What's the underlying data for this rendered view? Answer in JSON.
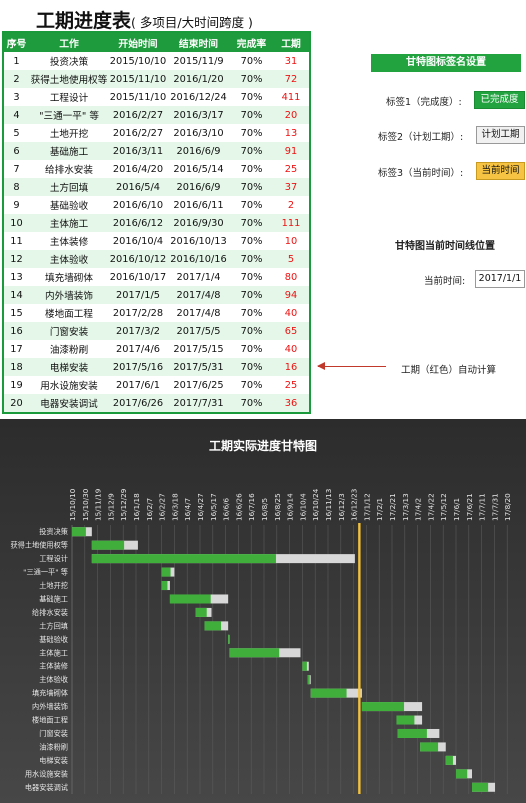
{
  "title": {
    "main": "工期进度表",
    "sub": "( 多项目/大时间跨度 )"
  },
  "table": {
    "headers": [
      "序号",
      "工作",
      "开始时间",
      "结束时间",
      "完成率",
      "工期"
    ],
    "rows": [
      [
        "1",
        "投资决策",
        "2015/10/10",
        "2015/11/9",
        "70%",
        "31"
      ],
      [
        "2",
        "获得土地使用权等",
        "2015/11/10",
        "2016/1/20",
        "70%",
        "72"
      ],
      [
        "3",
        "工程设计",
        "2015/11/10",
        "2016/12/24",
        "70%",
        "411"
      ],
      [
        "4",
        "\"三通一平\" 等",
        "2016/2/27",
        "2016/3/17",
        "70%",
        "20"
      ],
      [
        "5",
        "土地开挖",
        "2016/2/27",
        "2016/3/10",
        "70%",
        "13"
      ],
      [
        "6",
        "基础施工",
        "2016/3/11",
        "2016/6/9",
        "70%",
        "91"
      ],
      [
        "7",
        "给排水安装",
        "2016/4/20",
        "2016/5/14",
        "70%",
        "25"
      ],
      [
        "8",
        "土方回填",
        "2016/5/4",
        "2016/6/9",
        "70%",
        "37"
      ],
      [
        "9",
        "基础验收",
        "2016/6/10",
        "2016/6/11",
        "70%",
        "2"
      ],
      [
        "10",
        "主体施工",
        "2016/6/12",
        "2016/9/30",
        "70%",
        "111"
      ],
      [
        "11",
        "主体装修",
        "2016/10/4",
        "2016/10/13",
        "70%",
        "10"
      ],
      [
        "12",
        "主体验收",
        "2016/10/12",
        "2016/10/16",
        "70%",
        "5"
      ],
      [
        "13",
        "填充墙砌体",
        "2016/10/17",
        "2017/1/4",
        "70%",
        "80"
      ],
      [
        "14",
        "内外墙装饰",
        "2017/1/5",
        "2017/4/8",
        "70%",
        "94"
      ],
      [
        "15",
        "楼地面工程",
        "2017/2/28",
        "2017/4/8",
        "70%",
        "40"
      ],
      [
        "16",
        "门窗安装",
        "2017/3/2",
        "2017/5/5",
        "70%",
        "65"
      ],
      [
        "17",
        "油漆粉刷",
        "2017/4/6",
        "2017/5/15",
        "70%",
        "40"
      ],
      [
        "18",
        "电梯安装",
        "2017/5/16",
        "2017/5/31",
        "70%",
        "16"
      ],
      [
        "19",
        "用水设施安装",
        "2017/6/1",
        "2017/6/25",
        "70%",
        "25"
      ],
      [
        "20",
        "电器安装调试",
        "2017/6/26",
        "2017/7/31",
        "70%",
        "36"
      ]
    ]
  },
  "settings": {
    "title": "甘特图标签名设置",
    "label1": "标签1（完成度）:",
    "value1": "已完成度",
    "label2": "标签2（计划工期）:",
    "value2": "计划工期",
    "label3": "标签3（当前时间）:",
    "value3": "当前时间",
    "section_title": "甘特图当前时间线位置",
    "current_label": "当前时间:",
    "current_value": "2017/1/1",
    "note": "工期（红色）自动计算"
  },
  "colors": {
    "header_green": "#1e9b3c",
    "row_alt": "#e4f7e8",
    "duration_red": "#e11111",
    "btn_green": "#22a340",
    "btn_yellow": "#f6c342",
    "chart_bg": "#3b3b3b",
    "bar_done": "#3fae3a",
    "bar_plan": "#d8d8d8",
    "today_line": "#f3c13a"
  },
  "chart_data": {
    "type": "bar",
    "subtype": "gantt",
    "title": "工期实际进度甘特图",
    "tick_labels": [
      "15/10/10",
      "15/10/30",
      "15/11/19",
      "15/12/9",
      "15/12/29",
      "16/1/18",
      "16/2/7",
      "16/2/27",
      "16/3/18",
      "16/4/7",
      "16/4/27",
      "16/5/17",
      "16/6/6",
      "16/6/26",
      "16/7/16",
      "16/8/5",
      "16/8/25",
      "16/9/14",
      "16/10/4",
      "16/10/24",
      "16/11/13",
      "16/12/3",
      "16/12/23",
      "17/1/12",
      "17/2/1",
      "17/2/21",
      "17/3/13",
      "17/4/2",
      "17/4/22",
      "17/5/12",
      "17/6/1",
      "17/6/21",
      "17/7/11",
      "17/7/31",
      "17/8/20"
    ],
    "tasks": [
      "投资决策",
      "获得土地使用权等",
      "工程设计",
      "\"三通一平\" 等",
      "土地开挖",
      "基础施工",
      "给排水安装",
      "土方回填",
      "基础验收",
      "主体施工",
      "主体装修",
      "主体验收",
      "填充墙砌体",
      "内外墙装饰",
      "楼地面工程",
      "门窗安装",
      "油漆粉刷",
      "电梯安装",
      "用水设施安装",
      "电器安装调试"
    ],
    "start": [
      "2015-10-10",
      "2015-11-10",
      "2015-11-10",
      "2016-02-27",
      "2016-02-27",
      "2016-03-11",
      "2016-04-20",
      "2016-05-04",
      "2016-06-10",
      "2016-06-12",
      "2016-10-04",
      "2016-10-12",
      "2016-10-17",
      "2017-01-05",
      "2017-02-28",
      "2017-03-02",
      "2017-04-06",
      "2017-05-16",
      "2017-06-01",
      "2017-06-26"
    ],
    "duration_days": [
      31,
      72,
      411,
      20,
      13,
      91,
      25,
      37,
      2,
      111,
      10,
      5,
      80,
      94,
      40,
      65,
      40,
      16,
      25,
      36
    ],
    "completion": 0.7,
    "today": "2017-01-01",
    "xlim": [
      "2015-10-10",
      "2017-09-09"
    ]
  }
}
